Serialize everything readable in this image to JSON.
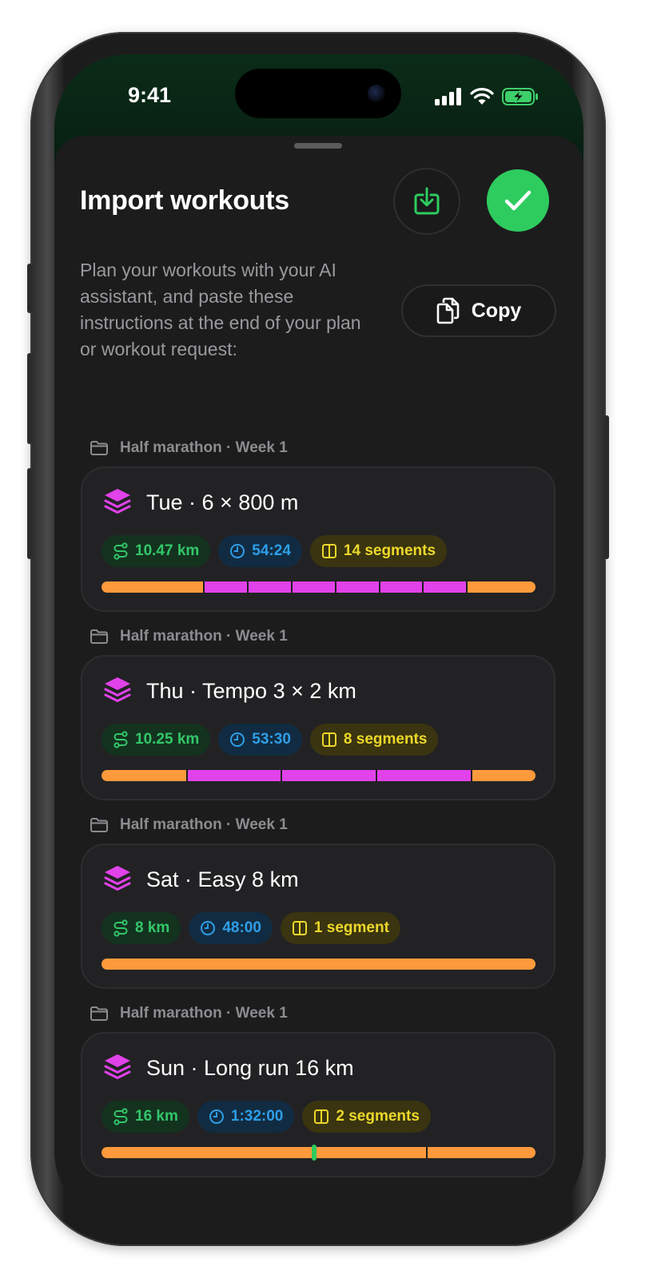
{
  "status": {
    "time": "9:41"
  },
  "header": {
    "title": "Import workouts"
  },
  "instructions": {
    "text": "Plan your workouts with your AI assistant, and paste these instructions at the end of your plan or workout request:",
    "copy_label": "Copy"
  },
  "colors": {
    "accent": "#2ecc5f",
    "distance": "#34c66a",
    "duration": "#2f9ee8",
    "segments": "#ecd82a",
    "easy": "#ff9a3c",
    "interval": "#e142ea",
    "workout_icon": "#e142ea"
  },
  "icons": {
    "import": "tray-download-icon",
    "confirm": "checkmark-icon",
    "copy": "documents-icon",
    "folder": "folder-icon",
    "workout": "layers-icon",
    "distance": "route-icon",
    "duration": "clock-icon",
    "segments": "columns-icon"
  },
  "workouts": [
    {
      "group": "Half marathon · Week 1",
      "title": "Tue · 6 × 800 m",
      "distance": "10.47 km",
      "duration": "54:24",
      "segments": "14 segments",
      "bar": [
        {
          "type": "orange",
          "weight": 2.4
        },
        {
          "type": "pink",
          "weight": 1
        },
        {
          "type": "pink",
          "weight": 1
        },
        {
          "type": "pink",
          "weight": 1
        },
        {
          "type": "pink",
          "weight": 1
        },
        {
          "type": "pink",
          "weight": 1
        },
        {
          "type": "pink",
          "weight": 1
        },
        {
          "type": "orange",
          "weight": 1.6
        }
      ]
    },
    {
      "group": "Half marathon · Week 1",
      "title": "Thu · Tempo 3 × 2 km",
      "distance": "10.25 km",
      "duration": "53:30",
      "segments": "8 segments",
      "bar": [
        {
          "type": "orange",
          "weight": 2
        },
        {
          "type": "pink",
          "weight": 2.2
        },
        {
          "type": "pink",
          "weight": 2.2
        },
        {
          "type": "pink",
          "weight": 2.2
        },
        {
          "type": "orange",
          "weight": 1.5
        }
      ]
    },
    {
      "group": "Half marathon · Week 1",
      "title": "Sat · Easy 8 km",
      "distance": "8 km",
      "duration": "48:00",
      "segments": "1 segment",
      "bar": [
        {
          "type": "orange",
          "weight": 1
        }
      ]
    },
    {
      "group": "Half marathon · Week 1",
      "title": "Sun · Long run 16 km",
      "distance": "16 km",
      "duration": "1:32:00",
      "segments": "2 segments",
      "bar": [
        {
          "type": "orange",
          "weight": 3
        },
        {
          "type": "orange",
          "weight": 1
        }
      ],
      "marker_fraction": 0.49
    }
  ]
}
